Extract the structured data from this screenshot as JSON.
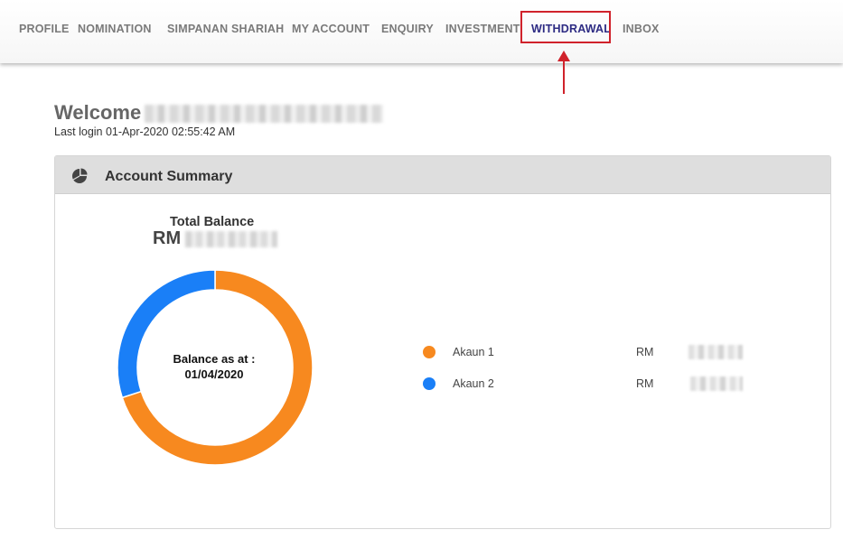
{
  "nav": {
    "items": [
      {
        "label": "PROFILE"
      },
      {
        "label": "NOMINATION"
      },
      {
        "label": "SIMPANAN SHARIAH"
      },
      {
        "label": "MY ACCOUNT"
      },
      {
        "label": "ENQUIRY"
      },
      {
        "label": "INVESTMENT"
      },
      {
        "label": "WITHDRAWAL"
      },
      {
        "label": "INBOX"
      }
    ],
    "highlighted": "WITHDRAWAL",
    "highlight_color": "#d0222b",
    "active_color": "#2d2b83"
  },
  "welcome": {
    "title": "Welcome",
    "last_login": "Last login 01-Apr-2020 02:55:42 AM"
  },
  "summary": {
    "title": "Account Summary",
    "icon": "pie-chart-icon",
    "total_label": "Total Balance",
    "currency": "RM",
    "center_line1": "Balance as at :",
    "center_line2": "01/04/2020"
  },
  "chart_data": {
    "type": "pie",
    "donut": true,
    "categories": [
      "Akaun 1",
      "Akaun 2"
    ],
    "values": [
      70,
      30
    ],
    "colors": [
      "#f7891f",
      "#1a7ff7"
    ]
  },
  "legend": {
    "items": [
      {
        "label": "Akaun 1",
        "currency": "RM",
        "color": "#f7891f"
      },
      {
        "label": "Akaun 2",
        "currency": "RM",
        "color": "#1a7ff7"
      }
    ]
  }
}
